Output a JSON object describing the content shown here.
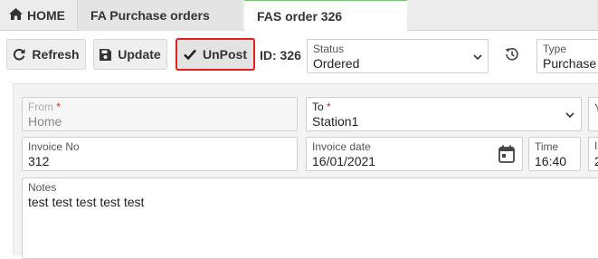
{
  "tabs": {
    "home": "HOME",
    "purchase_orders": "FA Purchase orders",
    "active": "FAS order 326"
  },
  "toolbar": {
    "refresh_label": "Refresh",
    "update_label": "Update",
    "unpost_label": "UnPost",
    "id_label": "ID: 326",
    "status_label": "Status",
    "status_value": "Ordered",
    "type_label": "Type",
    "type_value": "Purchase"
  },
  "form": {
    "from_label": "From",
    "from_value": "Home",
    "to_label": "To",
    "to_value": "Station1",
    "invoice_no_label": "Invoice No",
    "invoice_no_value": "312",
    "invoice_date_label": "Invoice date",
    "invoice_date_value": "16/01/2021",
    "time_label": "Time",
    "time_value": "16:40",
    "notes_label": "Notes",
    "notes_value": "test test test test test",
    "edge_col_row1_label": "Y",
    "edge_col_row2_label": "I",
    "edge_col_row2_value": "2"
  },
  "colors": {
    "highlight_border": "#e0201e",
    "active_tab_accent": "#7cc576",
    "required_star": "#e0201e"
  },
  "icons": [
    "home-icon",
    "refresh-icon",
    "save-icon",
    "check-icon",
    "history-icon",
    "chevron-down-icon",
    "calendar-icon"
  ]
}
